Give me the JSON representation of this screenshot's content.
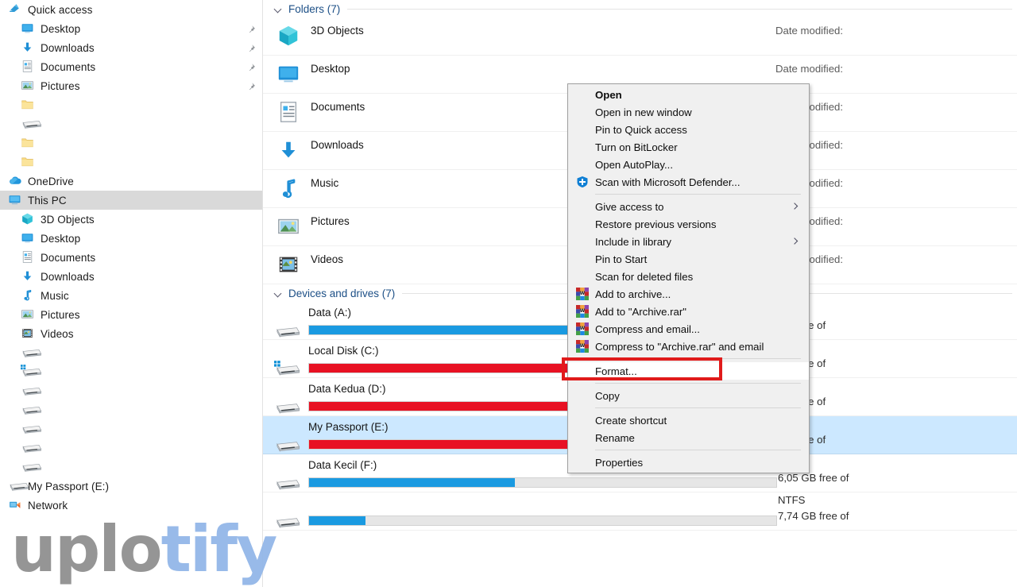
{
  "colors": {
    "accent_blue": "#1a9ae1",
    "bar_red": "#e81123",
    "selection_blue": "#cce8ff",
    "group_header": "#1c4f86",
    "highlight_red": "#e01b1b",
    "nav_selected": "#d9d9d9"
  },
  "nav_pane": {
    "items": [
      {
        "label": "Quick access",
        "icon": "pin-star-icon",
        "indent": 10,
        "pinned": false,
        "selected": false
      },
      {
        "label": "Desktop",
        "icon": "desktop-icon",
        "indent": 26,
        "pinned": true,
        "selected": false
      },
      {
        "label": "Downloads",
        "icon": "downloads-icon",
        "indent": 26,
        "pinned": true,
        "selected": false
      },
      {
        "label": "Documents",
        "icon": "documents-icon",
        "indent": 26,
        "pinned": true,
        "selected": false
      },
      {
        "label": "Pictures",
        "icon": "pictures-icon",
        "indent": 26,
        "pinned": true,
        "selected": false
      },
      {
        "label": "",
        "icon": "folder-icon",
        "indent": 26,
        "pinned": false,
        "selected": false
      },
      {
        "label": "",
        "icon": "drive-icon",
        "indent": 26,
        "pinned": false,
        "selected": false
      },
      {
        "label": "",
        "icon": "folder-icon",
        "indent": 26,
        "pinned": false,
        "selected": false
      },
      {
        "label": "",
        "icon": "folder-icon",
        "indent": 26,
        "pinned": false,
        "selected": false
      },
      {
        "label": "OneDrive",
        "icon": "onedrive-icon",
        "indent": 10,
        "pinned": false,
        "selected": false
      },
      {
        "label": "This PC",
        "icon": "thispc-icon",
        "indent": 10,
        "pinned": false,
        "selected": true
      },
      {
        "label": "3D Objects",
        "icon": "3dobjects-icon",
        "indent": 26,
        "pinned": false,
        "selected": false
      },
      {
        "label": "Desktop",
        "icon": "desktop-icon",
        "indent": 26,
        "pinned": false,
        "selected": false
      },
      {
        "label": "Documents",
        "icon": "documents-icon",
        "indent": 26,
        "pinned": false,
        "selected": false
      },
      {
        "label": "Downloads",
        "icon": "downloads-icon",
        "indent": 26,
        "pinned": false,
        "selected": false
      },
      {
        "label": "Music",
        "icon": "music-icon",
        "indent": 26,
        "pinned": false,
        "selected": false
      },
      {
        "label": "Pictures",
        "icon": "pictures-icon",
        "indent": 26,
        "pinned": false,
        "selected": false
      },
      {
        "label": "Videos",
        "icon": "videos-icon",
        "indent": 26,
        "pinned": false,
        "selected": false
      },
      {
        "label": "",
        "icon": "drive-icon",
        "indent": 26,
        "pinned": false,
        "selected": false
      },
      {
        "label": "",
        "icon": "windows-drive-icon",
        "indent": 26,
        "pinned": false,
        "selected": false
      },
      {
        "label": "",
        "icon": "drive-icon",
        "indent": 26,
        "pinned": false,
        "selected": false
      },
      {
        "label": "",
        "icon": "drive-icon",
        "indent": 26,
        "pinned": false,
        "selected": false
      },
      {
        "label": "",
        "icon": "drive-icon",
        "indent": 26,
        "pinned": false,
        "selected": false
      },
      {
        "label": "",
        "icon": "drive-icon",
        "indent": 26,
        "pinned": false,
        "selected": false
      },
      {
        "label": "",
        "icon": "drive-icon",
        "indent": 26,
        "pinned": false,
        "selected": false
      },
      {
        "label": "My Passport (E:)",
        "icon": "drive-icon",
        "indent": 10,
        "pinned": false,
        "selected": false
      },
      {
        "label": "Network",
        "icon": "network-icon",
        "indent": 10,
        "pinned": false,
        "selected": false
      }
    ]
  },
  "content": {
    "folders_group": {
      "title": "Folders (7)",
      "items": [
        {
          "name": "3D Objects",
          "icon": "3dobjects-icon",
          "meta": "Date modified:"
        },
        {
          "name": "Desktop",
          "icon": "desktop-icon",
          "meta": "Date modified:"
        },
        {
          "name": "Documents",
          "icon": "documents-icon",
          "meta": "Date modified:"
        },
        {
          "name": "Downloads",
          "icon": "downloads-icon",
          "meta": "Date modified:"
        },
        {
          "name": "Music",
          "icon": "music-icon",
          "meta": "Date modified:"
        },
        {
          "name": "Pictures",
          "icon": "pictures-icon",
          "meta": "Date modified:"
        },
        {
          "name": "Videos",
          "icon": "videos-icon",
          "meta": "Date modified:"
        }
      ]
    },
    "drives_group": {
      "title": "Devices and drives (7)",
      "items": [
        {
          "name": "Data (A:)",
          "icon": "drive-icon",
          "fill_percent": 100,
          "bar_color": "#1a9ae1",
          "filesystem": "",
          "free_text": "GB free of",
          "selected": false
        },
        {
          "name": "Local Disk (C:)",
          "icon": "windows-drive-icon",
          "fill_percent": 100,
          "bar_color": "#e81123",
          "filesystem": "",
          "free_text": "GB free of",
          "selected": false
        },
        {
          "name": "Data Kedua (D:)",
          "icon": "drive-icon",
          "fill_percent": 100,
          "bar_color": "#e81123",
          "filesystem": "",
          "free_text": "GB free of",
          "selected": false
        },
        {
          "name": "My Passport (E:)",
          "icon": "drive-icon",
          "fill_percent": 100,
          "bar_color": "#e81123",
          "filesystem": "",
          "free_text": "GB free of",
          "selected": true
        },
        {
          "name": "Data Kecil (F:)",
          "icon": "drive-icon",
          "fill_percent": 44,
          "bar_color": "#1a9ae1",
          "filesystem": "NTFS",
          "free_text": "6,05 GB free of",
          "selected": false
        },
        {
          "name": "",
          "icon": "drive-icon",
          "fill_percent": 12,
          "bar_color": "#1a9ae1",
          "filesystem": "NTFS",
          "free_text": "7,74 GB free of",
          "selected": false
        }
      ]
    }
  },
  "context_menu": {
    "items": [
      {
        "label": "Open",
        "type": "item",
        "bold": true,
        "icon": "",
        "submenu": false,
        "highlighted": false
      },
      {
        "label": "Open in new window",
        "type": "item",
        "bold": false,
        "icon": "",
        "submenu": false,
        "highlighted": false
      },
      {
        "label": "Pin to Quick access",
        "type": "item",
        "bold": false,
        "icon": "",
        "submenu": false,
        "highlighted": false
      },
      {
        "label": "Turn on BitLocker",
        "type": "item",
        "bold": false,
        "icon": "",
        "submenu": false,
        "highlighted": false
      },
      {
        "label": "Open AutoPlay...",
        "type": "item",
        "bold": false,
        "icon": "",
        "submenu": false,
        "highlighted": false
      },
      {
        "label": "Scan with Microsoft Defender...",
        "type": "item",
        "bold": false,
        "icon": "defender-shield-icon",
        "submenu": false,
        "highlighted": false
      },
      {
        "label": "",
        "type": "separator"
      },
      {
        "label": "Give access to",
        "type": "item",
        "bold": false,
        "icon": "",
        "submenu": true,
        "highlighted": false
      },
      {
        "label": "Restore previous versions",
        "type": "item",
        "bold": false,
        "icon": "",
        "submenu": false,
        "highlighted": false
      },
      {
        "label": "Include in library",
        "type": "item",
        "bold": false,
        "icon": "",
        "submenu": true,
        "highlighted": false
      },
      {
        "label": "Pin to Start",
        "type": "item",
        "bold": false,
        "icon": "",
        "submenu": false,
        "highlighted": false
      },
      {
        "label": "Scan for deleted files",
        "type": "item",
        "bold": false,
        "icon": "",
        "submenu": false,
        "highlighted": false
      },
      {
        "label": "Add to archive...",
        "type": "item",
        "bold": false,
        "icon": "winrar-icon",
        "submenu": false,
        "highlighted": false
      },
      {
        "label": "Add to \"Archive.rar\"",
        "type": "item",
        "bold": false,
        "icon": "winrar-icon",
        "submenu": false,
        "highlighted": false
      },
      {
        "label": "Compress and email...",
        "type": "item",
        "bold": false,
        "icon": "winrar-icon",
        "submenu": false,
        "highlighted": false
      },
      {
        "label": "Compress to \"Archive.rar\" and email",
        "type": "item",
        "bold": false,
        "icon": "winrar-icon",
        "submenu": false,
        "highlighted": false
      },
      {
        "label": "",
        "type": "separator"
      },
      {
        "label": "Format...",
        "type": "item",
        "bold": false,
        "icon": "",
        "submenu": false,
        "highlighted": true
      },
      {
        "label": "",
        "type": "separator"
      },
      {
        "label": "Copy",
        "type": "item",
        "bold": false,
        "icon": "",
        "submenu": false,
        "highlighted": false
      },
      {
        "label": "",
        "type": "separator"
      },
      {
        "label": "Create shortcut",
        "type": "item",
        "bold": false,
        "icon": "",
        "submenu": false,
        "highlighted": false
      },
      {
        "label": "Rename",
        "type": "item",
        "bold": false,
        "icon": "",
        "submenu": false,
        "highlighted": false
      },
      {
        "label": "",
        "type": "separator"
      },
      {
        "label": "Properties",
        "type": "item",
        "bold": false,
        "icon": "",
        "submenu": false,
        "highlighted": false
      }
    ]
  },
  "watermark": {
    "part1": "uplo",
    "part2": "tify"
  }
}
